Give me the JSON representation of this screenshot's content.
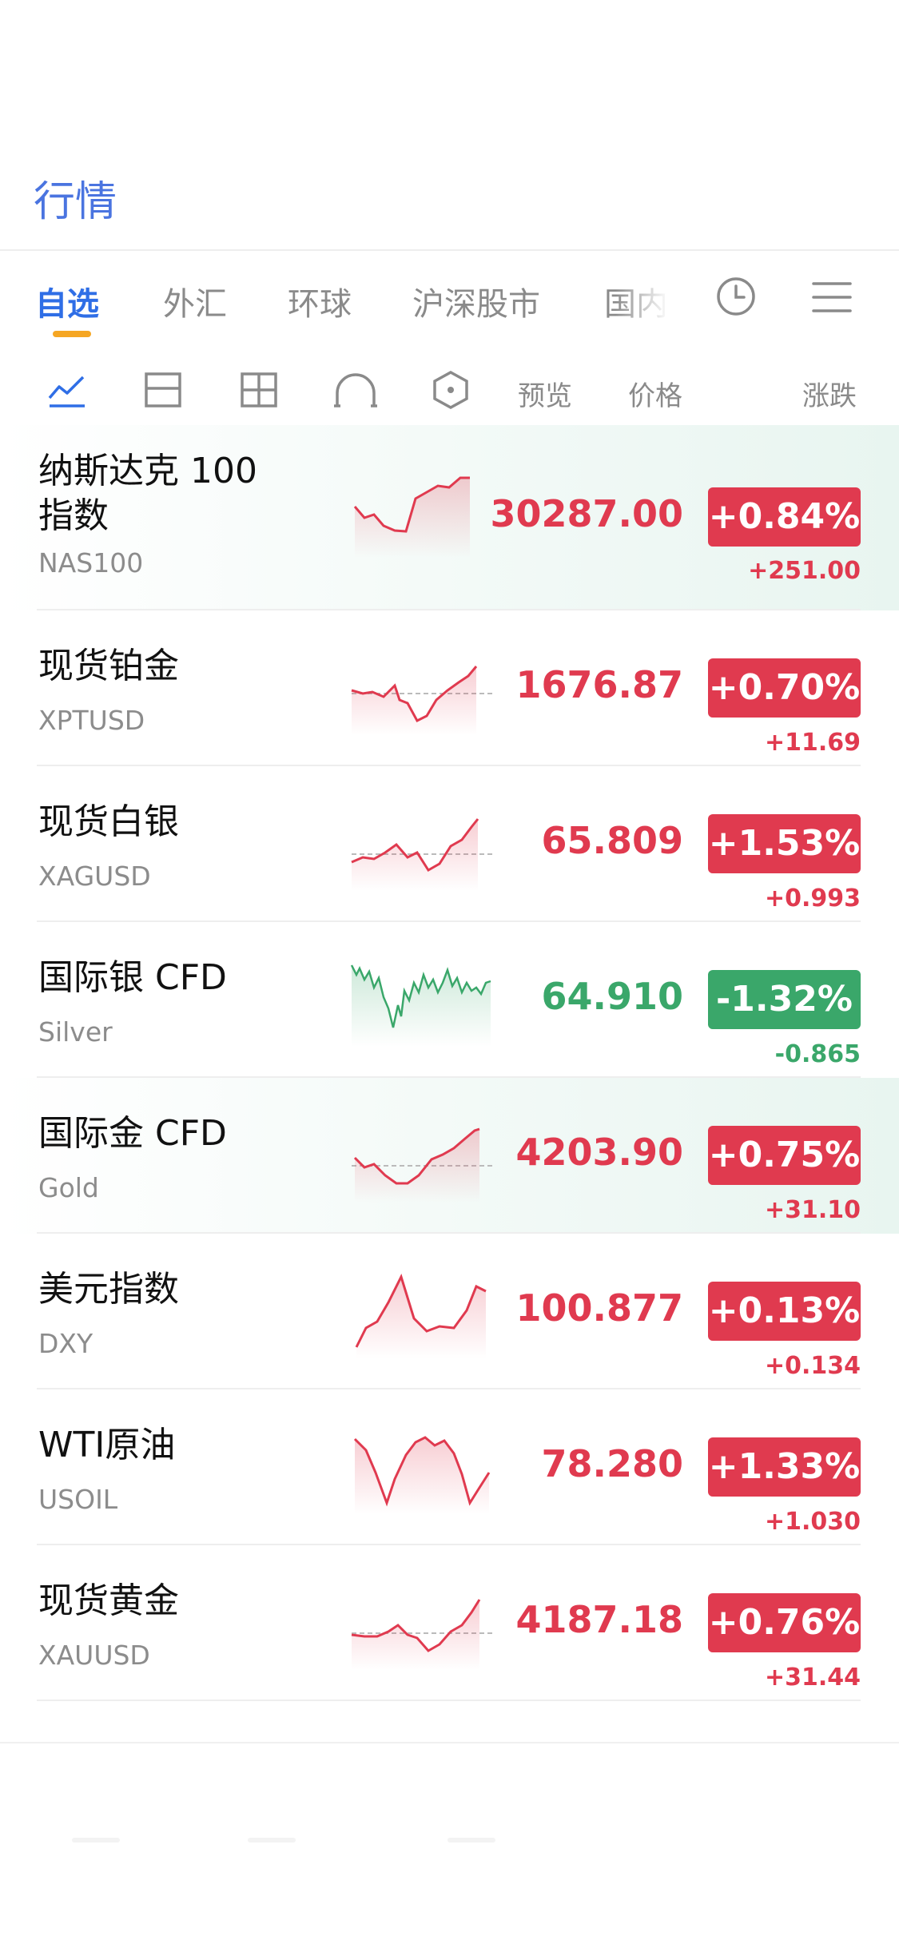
{
  "header": {
    "title": "行情"
  },
  "tabs": [
    {
      "label": "自选",
      "active": true
    },
    {
      "label": "外汇"
    },
    {
      "label": "环球"
    },
    {
      "label": "沪深股市"
    },
    {
      "label": "国内"
    }
  ],
  "header_icons": [
    "clock-icon",
    "menu-icon"
  ],
  "toolbar": {
    "icons": [
      "line-chart-icon",
      "single-panel-icon",
      "grid-panel-icon",
      "arc-icon",
      "hexagon-icon"
    ],
    "preview_label": "预览",
    "price_label": "价格",
    "change_label": "涨跌"
  },
  "colors": {
    "up": "#e03a4f",
    "down": "#3aa76a",
    "accent": "#2f6ee6",
    "tab_indicator": "#f5a623"
  },
  "quotes": [
    {
      "name": "纳斯达克 100 指数",
      "code": "NAS100",
      "price": "30287.00",
      "pct": "+0.84%",
      "change": "+251.00",
      "direction": "up",
      "highlighted": true
    },
    {
      "name": "现货铂金",
      "code": "XPTUSD",
      "price": "1676.87",
      "pct": "+0.70%",
      "change": "+11.69",
      "direction": "up"
    },
    {
      "name": "现货白银",
      "code": "XAGUSD",
      "price": "65.809",
      "pct": "+1.53%",
      "change": "+0.993",
      "direction": "up"
    },
    {
      "name": "国际银 CFD",
      "code": "Silver",
      "price": "64.910",
      "pct": "-1.32%",
      "change": "-0.865",
      "direction": "down"
    },
    {
      "name": "国际金 CFD",
      "code": "Gold",
      "price": "4203.90",
      "pct": "+0.75%",
      "change": "+31.10",
      "direction": "up",
      "highlighted": true
    },
    {
      "name": "美元指数",
      "code": "DXY",
      "price": "100.877",
      "pct": "+0.13%",
      "change": "+0.134",
      "direction": "up"
    },
    {
      "name": "WTI原油",
      "code": "USOIL",
      "price": "78.280",
      "pct": "+1.33%",
      "change": "+1.030",
      "direction": "up"
    },
    {
      "name": "现货黄金",
      "code": "XAUUSD",
      "price": "4187.18",
      "pct": "+0.76%",
      "change": "+31.44",
      "direction": "up"
    }
  ]
}
